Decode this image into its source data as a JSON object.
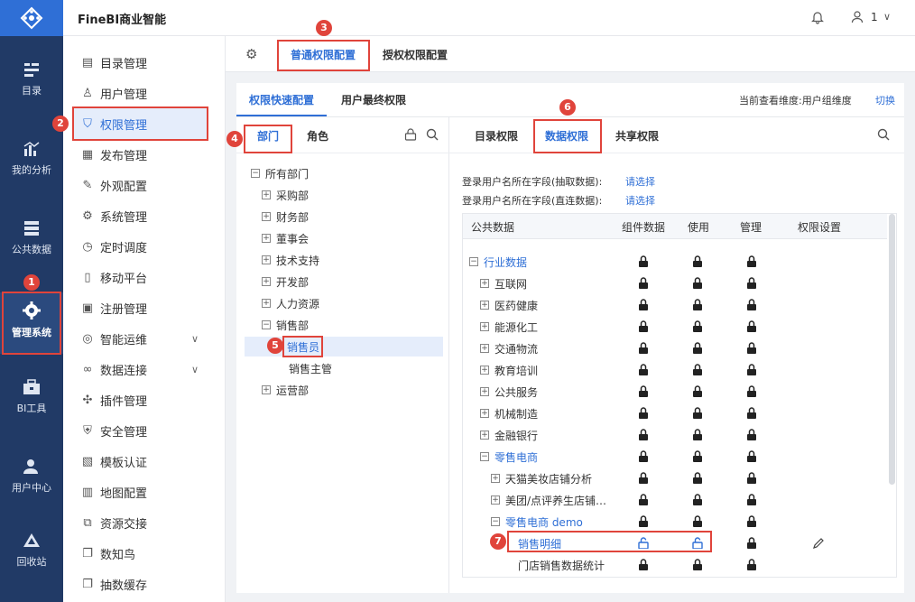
{
  "brand": "FineBI商业智能",
  "user": {
    "name": "1"
  },
  "nav": [
    {
      "id": "catalog",
      "label": "目录",
      "icon": "catalog-icon"
    },
    {
      "id": "analysis",
      "label": "我的分析",
      "icon": "chart-icon"
    },
    {
      "id": "public",
      "label": "公共数据",
      "icon": "database-icon"
    },
    {
      "id": "admin",
      "label": "管理系统",
      "icon": "gear-icon"
    },
    {
      "id": "bi",
      "label": "BI工具",
      "icon": "toolbox-icon"
    },
    {
      "id": "usercenter",
      "label": "用户中心",
      "icon": "user-icon"
    },
    {
      "id": "recycle",
      "label": "回收站",
      "icon": "recycle-icon"
    }
  ],
  "sidebar": [
    {
      "label": "目录管理"
    },
    {
      "label": "用户管理"
    },
    {
      "label": "权限管理"
    },
    {
      "label": "发布管理"
    },
    {
      "label": "外观配置"
    },
    {
      "label": "系统管理"
    },
    {
      "label": "定时调度"
    },
    {
      "label": "移动平台"
    },
    {
      "label": "注册管理"
    },
    {
      "label": "智能运维"
    },
    {
      "label": "数据连接"
    },
    {
      "label": "插件管理"
    },
    {
      "label": "安全管理"
    },
    {
      "label": "模板认证"
    },
    {
      "label": "地图配置"
    },
    {
      "label": "资源交接"
    },
    {
      "label": "数知鸟"
    },
    {
      "label": "抽数缓存"
    }
  ],
  "tabs": {
    "normal": "普通权限配置",
    "grant": "授权权限配置"
  },
  "subtabs": {
    "quick": "权限快速配置",
    "final": "用户最终权限"
  },
  "dimension": {
    "label": "当前查看维度:用户组维度",
    "switch": "切换"
  },
  "left": {
    "tab_dept": "部门",
    "tab_role": "角色",
    "tree": [
      "所有部门",
      "采购部",
      "财务部",
      "董事会",
      "技术支持",
      "开发部",
      "人力资源",
      "销售部",
      "销售员",
      "销售主管",
      "运营部"
    ]
  },
  "right": {
    "tabs": {
      "catalog": "目录权限",
      "data": "数据权限",
      "share": "共享权限"
    },
    "field1_label": "登录用户名所在字段(抽取数据):",
    "field2_label": "登录用户名所在字段(直连数据):",
    "select": "请选择",
    "columns": {
      "name": "公共数据",
      "comp": "组件数据",
      "use": "使用",
      "manage": "管理",
      "setting": "权限设置"
    },
    "rows": [
      "行业数据",
      "互联网",
      "医药健康",
      "能源化工",
      "交通物流",
      "教育培训",
      "公共服务",
      "机械制造",
      "金融银行",
      "零售电商",
      "天猫美妆店铺分析",
      "美团/点评养生店铺…",
      "零售电商 demo",
      "销售明细",
      "门店销售数据统计"
    ]
  },
  "badges": [
    "1",
    "2",
    "3",
    "4",
    "5",
    "6",
    "7"
  ]
}
